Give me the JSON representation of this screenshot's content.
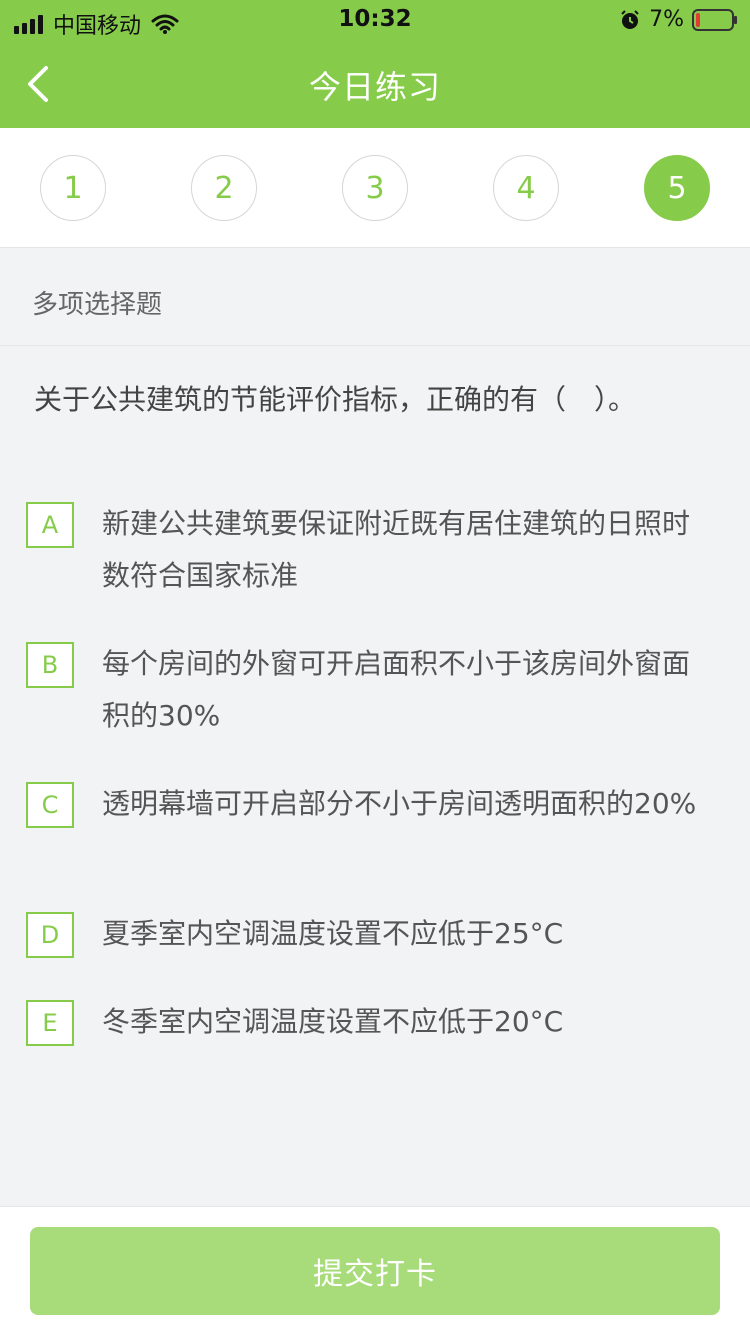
{
  "status_bar": {
    "carrier": "中国移动",
    "time": "10:32",
    "battery": "7%"
  },
  "nav": {
    "title": "今日练习"
  },
  "steps": [
    "1",
    "2",
    "3",
    "4",
    "5"
  ],
  "active_step": "5",
  "question": {
    "type": "多项选择题",
    "text": "关于公共建筑的节能评价指标，正确的有（　）。",
    "options": [
      {
        "letter": "A",
        "text": "新建公共建筑要保证附近既有居住建筑的日照时数符合国家标准"
      },
      {
        "letter": "B",
        "text": "每个房间的外窗可开启面积不小于该房间外窗面积的30%"
      },
      {
        "letter": "C",
        "text": "透明幕墙可开启部分不小于房间透明面积的20%"
      },
      {
        "letter": "D",
        "text": "夏季室内空调温度设置不应低于25°C"
      },
      {
        "letter": "E",
        "text": "冬季室内空调温度设置不应低于20°C"
      }
    ]
  },
  "submit_label": "提交打卡",
  "colors": {
    "accent": "#86cc4a",
    "button_disabled": "#a8dc7b",
    "background": "#f2f3f5"
  }
}
